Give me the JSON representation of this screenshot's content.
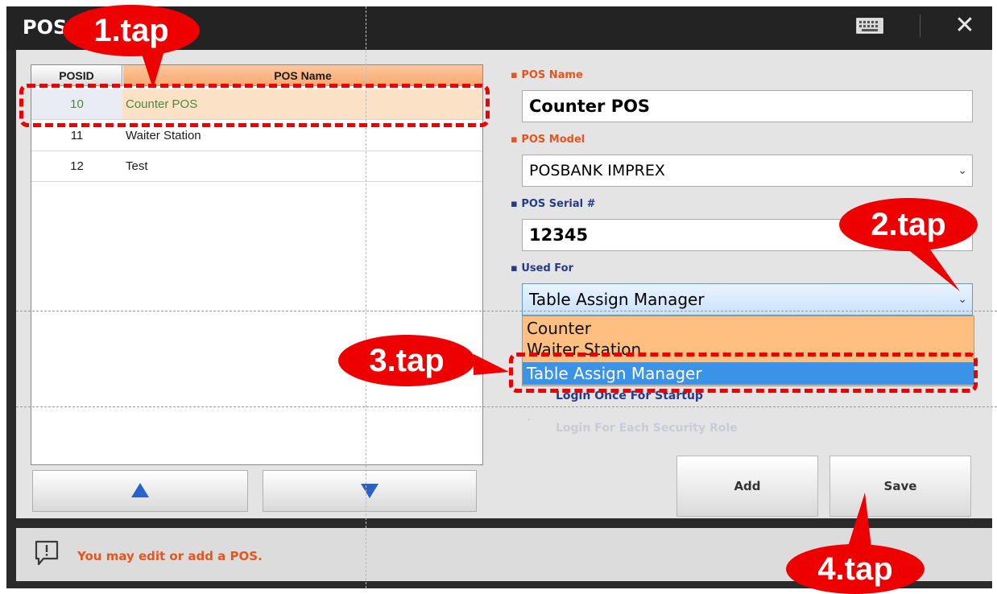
{
  "window": {
    "title": "POS",
    "keyboard_icon": "keyboard-icon",
    "close_icon": "close-icon"
  },
  "pos_table": {
    "headers": [
      "POSID",
      "POS Name"
    ],
    "rows": [
      {
        "id": "10",
        "name": "Counter POS",
        "selected": true
      },
      {
        "id": "11",
        "name": "Waiter Station",
        "selected": false
      },
      {
        "id": "12",
        "name": "Test",
        "selected": false
      }
    ],
    "up_icon": "triangle-up-icon",
    "down_icon": "triangle-down-icon"
  },
  "form": {
    "pos_name_label": "POS Name",
    "pos_name_value": "Counter POS",
    "pos_model_label": "POS Model",
    "pos_model_value": "POSBANK IMPREX",
    "pos_serial_label": "POS Serial #",
    "pos_serial_value": "12345",
    "used_for_label": "Used For",
    "used_for_value": "Table Assign Manager",
    "used_for_options": [
      "Counter",
      "Waiter Station",
      "Table Assign Manager"
    ],
    "login_once_label": "Login Once For Startup",
    "login_each_label": "Login For Each Security Role",
    "add_label": "Add",
    "save_label": "Save"
  },
  "message": {
    "text": "You may edit or add a POS.",
    "icon": "message-alert-icon"
  },
  "annotations": {
    "step1": "1.tap",
    "step2": "2.tap",
    "step3": "3.tap",
    "step4": "4.tap"
  },
  "colors": {
    "title_bar": "#232323",
    "header_highlight": "#f7a870",
    "dropdown_bg": "#ffbf80",
    "selected_option": "#3a93e6",
    "label_orange": "#e8551c",
    "label_blue": "#263c88",
    "annotation_red": "#ee0000"
  }
}
